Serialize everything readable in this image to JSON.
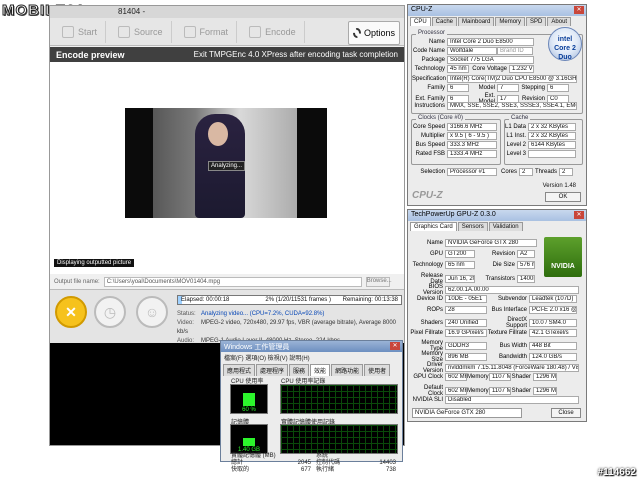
{
  "watermark": {
    "brand": "MOBILE01",
    "post_id": "#114662"
  },
  "tmpgenc": {
    "title": "81404 -",
    "toolbar": {
      "start": "Start",
      "source": "Source",
      "format": "Format",
      "encode": "Encode",
      "options": "Options"
    },
    "encode_bar": {
      "label": "Encode preview",
      "exit_option": "Exit TMPGEnc 4.0 XPress after encoding task completion"
    },
    "preview": {
      "analyzing": "Analyzing...",
      "display_note": "Displaying outputted picture"
    },
    "source_label": "Output file name:",
    "source_path": "C:\\Users\\yoal\\Documents\\MOV01404.mpg",
    "browse_label": "Browse...",
    "progress": {
      "elapsed": "Elapsed: 00:00:18",
      "percent_text": "2% (1/20/11531 frames )",
      "remaining": "Remaining: 00:13:38",
      "value": 2
    },
    "info": {
      "status_label": "Status:",
      "status_value": "Analyzing video...",
      "status_extra": "(CPU=7.2%, CUDA=92.8%)",
      "video_label": "Video:",
      "video_value": "MPEG-2 video, 720x480, 29.97 fps, VBR (average bitrate), Average 8000 kb/s",
      "audio_label": "Audio:",
      "audio_value": "MPEG-1 Audio Layer II, 48000 Hz, Stereo, 224 kbps"
    }
  },
  "cpuz": {
    "title": "CPU-Z",
    "tabs": [
      "CPU",
      "Cache",
      "Mainboard",
      "Memory",
      "SPD",
      "About"
    ],
    "processor_group": "Processor",
    "name": "Intel Core 2 Duo E8500",
    "code_name": "Wolfdale",
    "brand_id": "Brand ID",
    "package": "Socket 775 LGA",
    "technology": "45 nm",
    "core_voltage": "1.232 V",
    "specification": "Intel(R) Core(TM)2 Duo CPU E8500 @ 3.16GHz (ES)",
    "family": "6",
    "model": "7",
    "stepping": "6",
    "ext_family": "6",
    "ext_model": "17",
    "revision": "C0",
    "instructions": "MMX, SSE, SSE2, SSE3, SSSE3, SSE4.1, EM64T",
    "clocks_group": "Clocks (Core #0)",
    "core_speed": "3166.6 MHz",
    "multiplier": "x 9.5 ( 6 - 9.5 )",
    "bus_speed": "333.3 MHz",
    "rated_fsb": "1333.4 MHz",
    "cache_group": "Cache",
    "l1_data": "2 x 32 KBytes",
    "l1_inst": "2 x 32 KBytes",
    "level2": "6144 KBytes",
    "level3": "",
    "selection": "Processor #1",
    "cores": "2",
    "threads": "2",
    "version": "Version 1.48",
    "ok": "OK",
    "labels": {
      "name": "Name",
      "code_name": "Code Name",
      "package": "Package",
      "technology": "Technology",
      "core_voltage": "Core Voltage",
      "specification": "Specification",
      "family": "Family",
      "model": "Model",
      "stepping": "Stepping",
      "ext_family": "Ext. Family",
      "ext_model": "Ext. Model",
      "revision": "Revision",
      "instructions": "Instructions",
      "core_speed": "Core Speed",
      "multiplier": "Multiplier",
      "bus_speed": "Bus Speed",
      "rated_fsb": "Rated FSB",
      "l1_data": "L1 Data",
      "l1_inst": "L1 Inst.",
      "level2": "Level 2",
      "level3": "Level 3",
      "selection": "Selection",
      "cores": "Cores",
      "threads": "Threads"
    },
    "intel_logo": "intel Core 2 Duo"
  },
  "gpuz": {
    "title": "TechPowerUp GPU-Z 0.3.0",
    "tabs": [
      "Graphics Card",
      "Sensors",
      "Validation"
    ],
    "rows": [
      {
        "k": "Name",
        "v": "NVIDIA GeForce GTX 280"
      },
      {
        "k": "GPU",
        "v": "GT200",
        "k2": "Revision",
        "v2": "A2"
      },
      {
        "k": "Technology",
        "v": "65 nm",
        "k2": "Die Size",
        "v2": "576 mm²"
      },
      {
        "k": "Release Date",
        "v": "Jun 16, 2008",
        "k2": "Transistors",
        "v2": "1400M"
      },
      {
        "k": "BIOS Version",
        "v": "62.00.1A.00.00"
      },
      {
        "k": "Device ID",
        "v": "10DE - 05E1",
        "k2": "Subvendor",
        "v2": "Leadtek (107D)"
      },
      {
        "k": "ROPs",
        "v": "28",
        "k2": "Bus Interface",
        "v2": "PCI-E 2.0 x16 @ x16 2.0"
      },
      {
        "k": "Shaders",
        "v": "240 Unified",
        "k2": "DirectX Support",
        "v2": "10.0 / SM4.0"
      },
      {
        "k": "Pixel Fillrate",
        "v": "16.9 GPixel/s",
        "k2": "Texture Fillrate",
        "v2": "42.1 GTexel/s"
      },
      {
        "k": "Memory Type",
        "v": "GDDR3",
        "k2": "Bus Width",
        "v2": "448 Bit"
      },
      {
        "k": "Memory Size",
        "v": "896 MB",
        "k2": "Bandwidth",
        "v2": "124.0 GB/s"
      },
      {
        "k": "Driver Version",
        "v": "nvlddmkm 7.15.11.8048 (ForceWare 180.48) / Vista"
      },
      {
        "k": "GPU Clock",
        "v": "602 MHz",
        "k2": "Memory",
        "v2": "1107 MHz",
        "k3": "Shader",
        "v3": "1296 MHz"
      },
      {
        "k": "Default Clock",
        "v": "602 MHz",
        "k2": "Memory",
        "v2": "1107 MHz",
        "k3": "Shader",
        "v3": "1296 MHz"
      },
      {
        "k": "NVIDIA SLI",
        "v": "Disabled"
      }
    ],
    "selected_card": "NVIDIA GeForce GTX 280",
    "close": "Close",
    "nvidia_logo": "NVIDIA"
  },
  "taskmgr": {
    "title": "Windows 工作管理員",
    "menu": "檔案(F)  選項(O)  檢視(V)  說明(H)",
    "tabs": [
      "應用程式",
      "處理程序",
      "服務",
      "效能",
      "網路功能",
      "使用者"
    ],
    "cpu_usage_label": "CPU 使用率",
    "cpu_usage_value": "60 %",
    "cpu_history_label": "CPU 使用率記錄",
    "mem_label": "記憶體",
    "mem_value": "1.40 GB",
    "mem_history_label": "實體記憶體使用記錄",
    "phys_mem_label": "實體記憶體 (MB)",
    "system_label": "系統",
    "stats_left": [
      {
        "k": "總計",
        "v": "2045"
      },
      {
        "k": "快取的",
        "v": "677"
      }
    ],
    "stats_right": [
      {
        "k": "控制代碼",
        "v": "14403"
      },
      {
        "k": "執行緒",
        "v": "738"
      }
    ]
  }
}
